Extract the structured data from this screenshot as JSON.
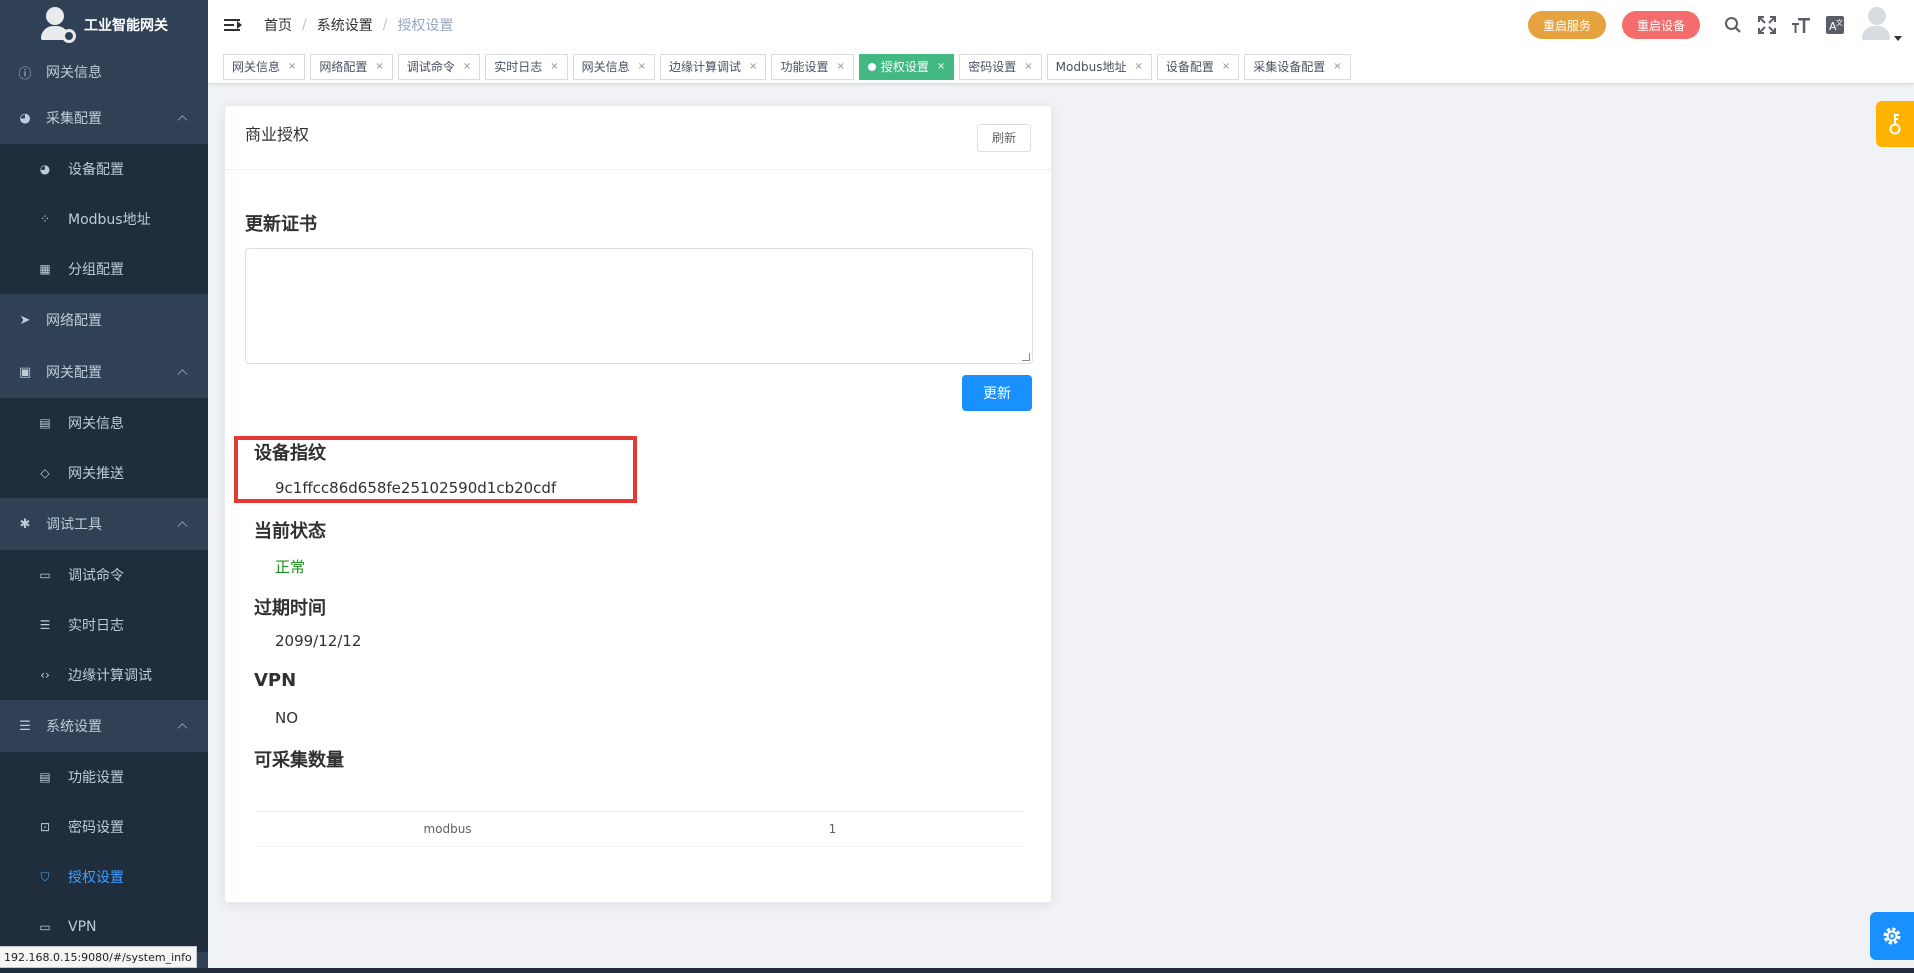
{
  "app": {
    "title": "工业智能网关"
  },
  "sidebar": {
    "items": [
      {
        "label": "网关信息",
        "icon": "info-icon",
        "level": "top"
      },
      {
        "label": "采集配置",
        "icon": "dashboard-icon",
        "level": "top",
        "expanded": true
      },
      {
        "label": "设备配置",
        "icon": "dashboard-icon",
        "level": "sub"
      },
      {
        "label": "Modbus地址",
        "icon": "grid-icon",
        "level": "sub"
      },
      {
        "label": "分组配置",
        "icon": "table-icon",
        "level": "sub"
      },
      {
        "label": "网络配置",
        "icon": "send-icon",
        "level": "top"
      },
      {
        "label": "网关配置",
        "icon": "lock-icon",
        "level": "top",
        "expanded": true
      },
      {
        "label": "网关信息",
        "icon": "doc-search-icon",
        "level": "sub"
      },
      {
        "label": "网关推送",
        "icon": "tag-icon",
        "level": "sub"
      },
      {
        "label": "调试工具",
        "icon": "bug-icon",
        "level": "top",
        "expanded": true
      },
      {
        "label": "调试命令",
        "icon": "terminal-icon",
        "level": "sub"
      },
      {
        "label": "实时日志",
        "icon": "list-icon",
        "level": "sub"
      },
      {
        "label": "边缘计算调试",
        "icon": "code-icon",
        "level": "sub"
      },
      {
        "label": "系统设置",
        "icon": "menu-icon",
        "level": "top",
        "expanded": true
      },
      {
        "label": "功能设置",
        "icon": "doc-edit-icon",
        "level": "sub"
      },
      {
        "label": "密码设置",
        "icon": "unlock-icon",
        "level": "sub"
      },
      {
        "label": "授权设置",
        "icon": "shield-icon",
        "level": "sub",
        "active": true
      },
      {
        "label": "VPN",
        "icon": "monitor-icon",
        "level": "sub"
      }
    ]
  },
  "status_url": "192.168.0.15:9080/#/system_info",
  "breadcrumb": [
    "首页",
    "系统设置",
    "授权设置"
  ],
  "navbar": {
    "restart_service": "重启服务",
    "restart_device": "重启设备"
  },
  "tags": [
    {
      "label": "网关信息"
    },
    {
      "label": "网络配置"
    },
    {
      "label": "调试命令"
    },
    {
      "label": "实时日志"
    },
    {
      "label": "网关信息"
    },
    {
      "label": "边缘计算调试"
    },
    {
      "label": "功能设置"
    },
    {
      "label": "授权设置",
      "active": true
    },
    {
      "label": "密码设置"
    },
    {
      "label": "Modbus地址"
    },
    {
      "label": "设备配置"
    },
    {
      "label": "采集设备配置"
    }
  ],
  "card": {
    "title": "商业授权",
    "refresh": "刷新",
    "update_cert_heading": "更新证书",
    "update_button": "更新",
    "fingerprint_heading": "设备指纹",
    "fingerprint_value": "9c1ffcc86d658fe25102590d1cb20cdf",
    "status_heading": "当前状态",
    "status_value": "正常",
    "expire_heading": "过期时间",
    "expire_value": "2099/12/12",
    "vpn_heading": "VPN",
    "vpn_value": "NO",
    "count_heading": "可采集数量",
    "count_rows": [
      {
        "protocol": "modbus",
        "count": "1"
      }
    ]
  },
  "colors": {
    "sidebar_bg": "#304156",
    "active": "#409eff",
    "tag_active": "#42b983",
    "primary": "#1890ff",
    "highlight": "#e53935"
  }
}
